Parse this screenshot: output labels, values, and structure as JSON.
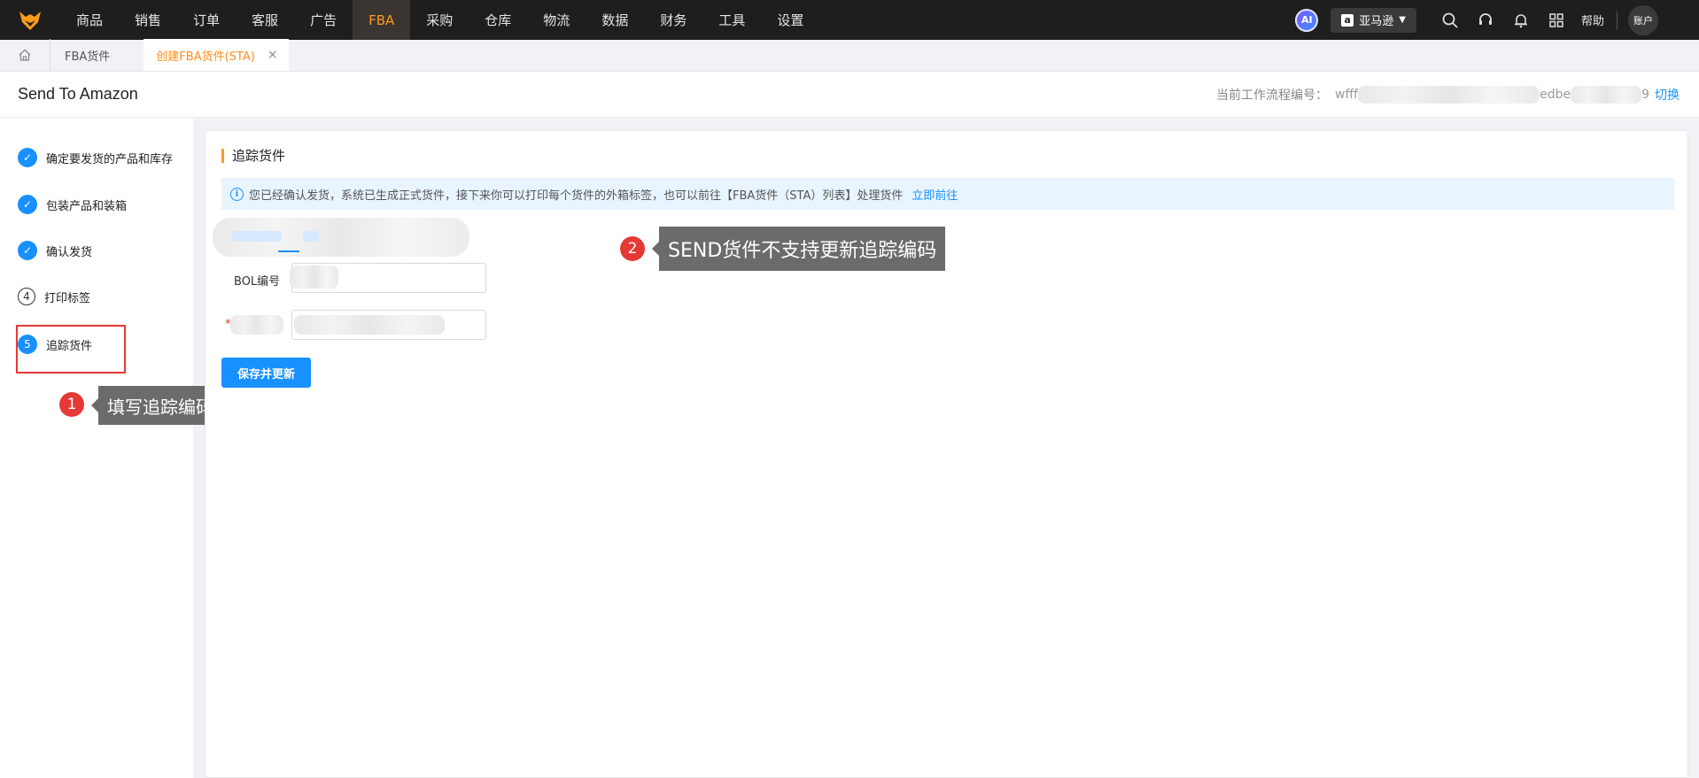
{
  "nav": {
    "items": [
      "商品",
      "销售",
      "订单",
      "客服",
      "广告",
      "FBA",
      "采购",
      "仓库",
      "物流",
      "数据",
      "财务",
      "工具",
      "设置"
    ],
    "active_index": 5,
    "ai_label": "AI",
    "store_label": "亚马逊",
    "help_label": "帮助",
    "account_label": "账户"
  },
  "tabs": {
    "items": [
      {
        "label": "FBA货件"
      },
      {
        "label": "创建FBA货件(STA)",
        "close": "×"
      }
    ]
  },
  "header": {
    "title": "Send To Amazon",
    "workflow_label": "当前工作流程编号：",
    "workflow_value_prefix": "wfff",
    "workflow_value_mid": "edbe",
    "workflow_value_suffix": "9",
    "switch_label": "切换"
  },
  "steps": [
    {
      "num": "✓",
      "label": "确定要发货的产品和库存",
      "state": "done"
    },
    {
      "num": "✓",
      "label": "包装产品和装箱",
      "state": "done"
    },
    {
      "num": "✓",
      "label": "确认发货",
      "state": "done"
    },
    {
      "num": "4",
      "label": "打印标签",
      "state": "todo"
    },
    {
      "num": "5",
      "label": "追踪货件",
      "state": "current"
    }
  ],
  "main": {
    "section_title": "追踪货件",
    "info_text": "您已经确认发货，系统已生成正式货件，接下来你可以打印每个货件的外箱标签，也可以前往【FBA货件（STA）列表】处理货件",
    "info_link": "立即前往",
    "bol_label": "BOL编号",
    "required_mark": "*",
    "save_button": "保存并更新"
  },
  "callouts": [
    {
      "num": "1",
      "text": "填写追踪编码"
    },
    {
      "num": "2",
      "text": "SEND货件不支持更新追踪编码"
    }
  ],
  "colors": {
    "nav_bg": "#1f1e1c",
    "accent_orange": "#ff9a1f",
    "primary_blue": "#1890ff",
    "callout_red": "#e53935",
    "callout_bg": "#6b6b6b"
  }
}
